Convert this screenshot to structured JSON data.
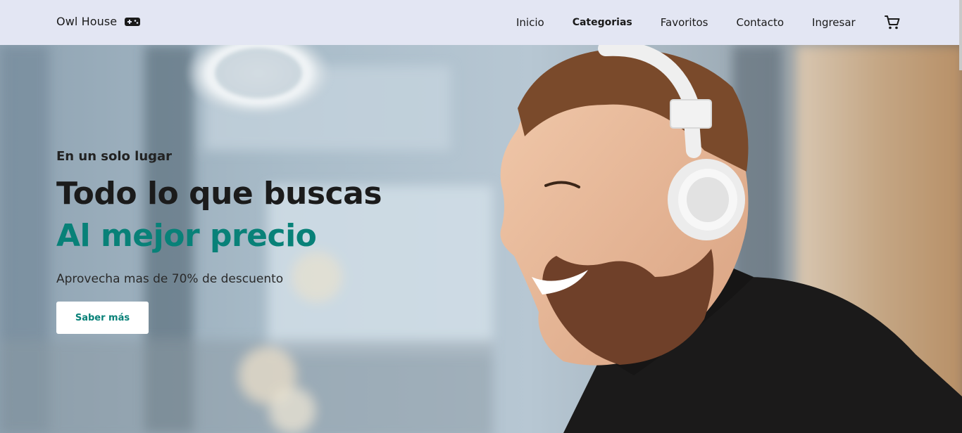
{
  "header": {
    "brand": "Owl House",
    "nav": [
      "Inicio",
      "Categorias",
      "Favoritos",
      "Contacto",
      "Ingresar"
    ]
  },
  "hero": {
    "eyebrow": "En un solo lugar",
    "headline": "Todo lo que buscas",
    "accent_line": "Al mejor precio",
    "subtitle": "Aprovecha mas de 70% de descuento",
    "cta_label": "Saber más"
  },
  "colors": {
    "nav_bg": "#e3e6f3",
    "accent": "#088178",
    "text": "#1b1b1b"
  },
  "icons": {
    "brand_icon": "gamepad-icon",
    "cart_icon": "cart-icon"
  }
}
